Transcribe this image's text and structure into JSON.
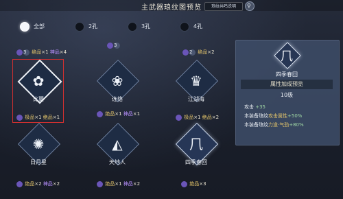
{
  "header": {
    "title": "主武器琅纹图预览",
    "help": "琅纹共鸣说明",
    "search_icon": "search-icon"
  },
  "filters": [
    {
      "label": "全部",
      "selected": true
    },
    {
      "label": "2孔",
      "selected": false
    },
    {
      "label": "3孔",
      "selected": false
    },
    {
      "label": "4孔",
      "selected": false
    }
  ],
  "top_stats": [
    {
      "n1": "3",
      "w1": "绝品",
      "v1": "×1",
      "w2": "神品",
      "v2": "×4"
    },
    {
      "n1": "3"
    },
    {
      "n1": "2",
      "w1": "绝品",
      "v1": "×2"
    }
  ],
  "cards": [
    {
      "name": "比翼",
      "glyph": "✿",
      "q1": "极品",
      "c1": "×1",
      "q2": "绝品",
      "c2": "×1",
      "n": "2",
      "selected": true
    },
    {
      "name": "连络",
      "glyph": "❀",
      "q1": "绝品",
      "c1": "×1",
      "q2": "神品",
      "c2": "×1",
      "n": "2"
    },
    {
      "name": "江湖海",
      "glyph": "♛",
      "q1": "极品",
      "c1": "×1",
      "q2": "绝品",
      "c2": "×2",
      "n": "3"
    },
    {
      "name": "日月星",
      "glyph": "✺",
      "q1": "绝品",
      "c1": "×2",
      "q2": "神品",
      "c2": "×2",
      "n": "3"
    },
    {
      "name": "天地人",
      "glyph": "◭",
      "q1": "绝品",
      "c1": "×1",
      "q2": "神品",
      "c2": "×2",
      "n": "3"
    },
    {
      "name": "四季春回",
      "glyph": "⺇",
      "q1": "绝品",
      "c1": "×3",
      "n": "3",
      "lit": true
    }
  ],
  "panel": {
    "name": "四季春回",
    "heading": "属性加成预览",
    "level": "10级",
    "attack_label": "攻击",
    "attack_value": "+35",
    "line2_prefix": "本装备琅纹",
    "line2_attr": "攻击属性",
    "line2_value": "+50%",
    "line3_prefix": "本装备琅纹",
    "line3_attr": "力道",
    "line3_attr2": "气劲",
    "line3_value": "+80%"
  }
}
